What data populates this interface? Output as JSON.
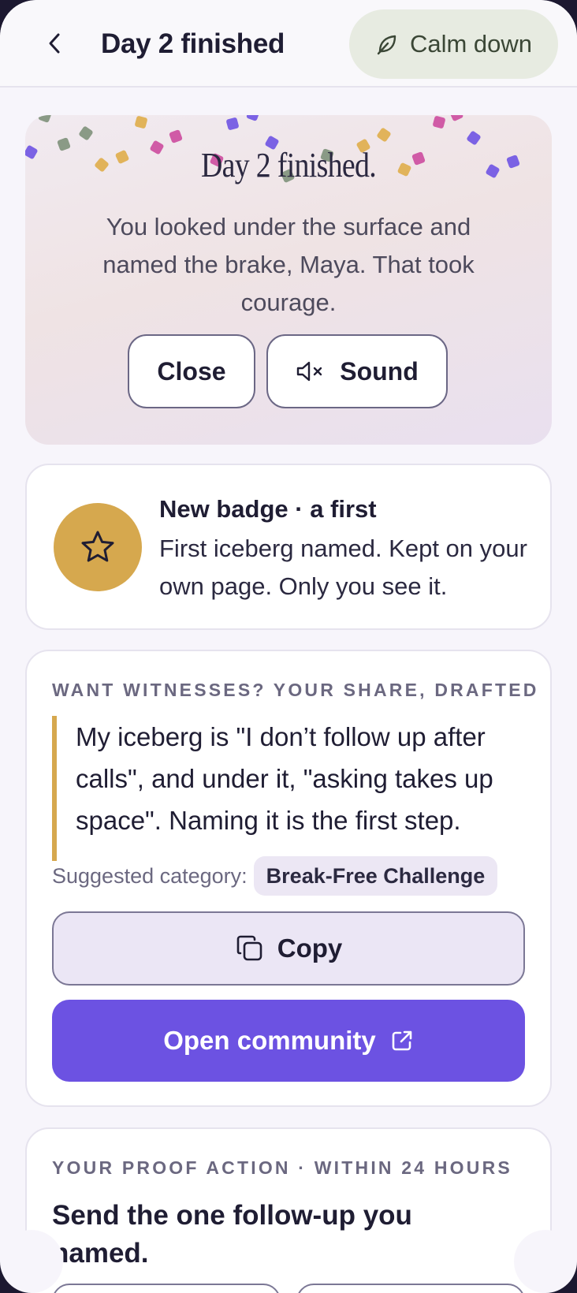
{
  "header": {
    "title": "Day 2 finished",
    "calm_label": "Calm down"
  },
  "celebration": {
    "title": "Day 2 finished.",
    "body": "You looked under the surface and named the brake, Maya. That took courage.",
    "close_label": "Close",
    "sound_label": "Sound"
  },
  "badge": {
    "title": "New badge · a first",
    "text": "First iceberg named. Kept on your own page. Only you see it.",
    "icon": "star-icon"
  },
  "share": {
    "eyebrow": "WANT WITNESSES? YOUR SHARE, DRAFTED",
    "quote": "My iceberg is \"I don’t follow up after calls\", and under it, \"asking takes up space\". Naming it is the first step.",
    "category_label": "Suggested category:",
    "category_value": "Break-Free Challenge",
    "copy_label": "Copy",
    "community_label": "Open community"
  },
  "proof": {
    "eyebrow": "YOUR PROOF ACTION · WITHIN 24 HOURS",
    "title": "Send the one follow-up you named."
  },
  "colors": {
    "accent": "#6c52e2",
    "badge_gold": "#d6a84e",
    "calm_bg": "#e7ebe1"
  }
}
